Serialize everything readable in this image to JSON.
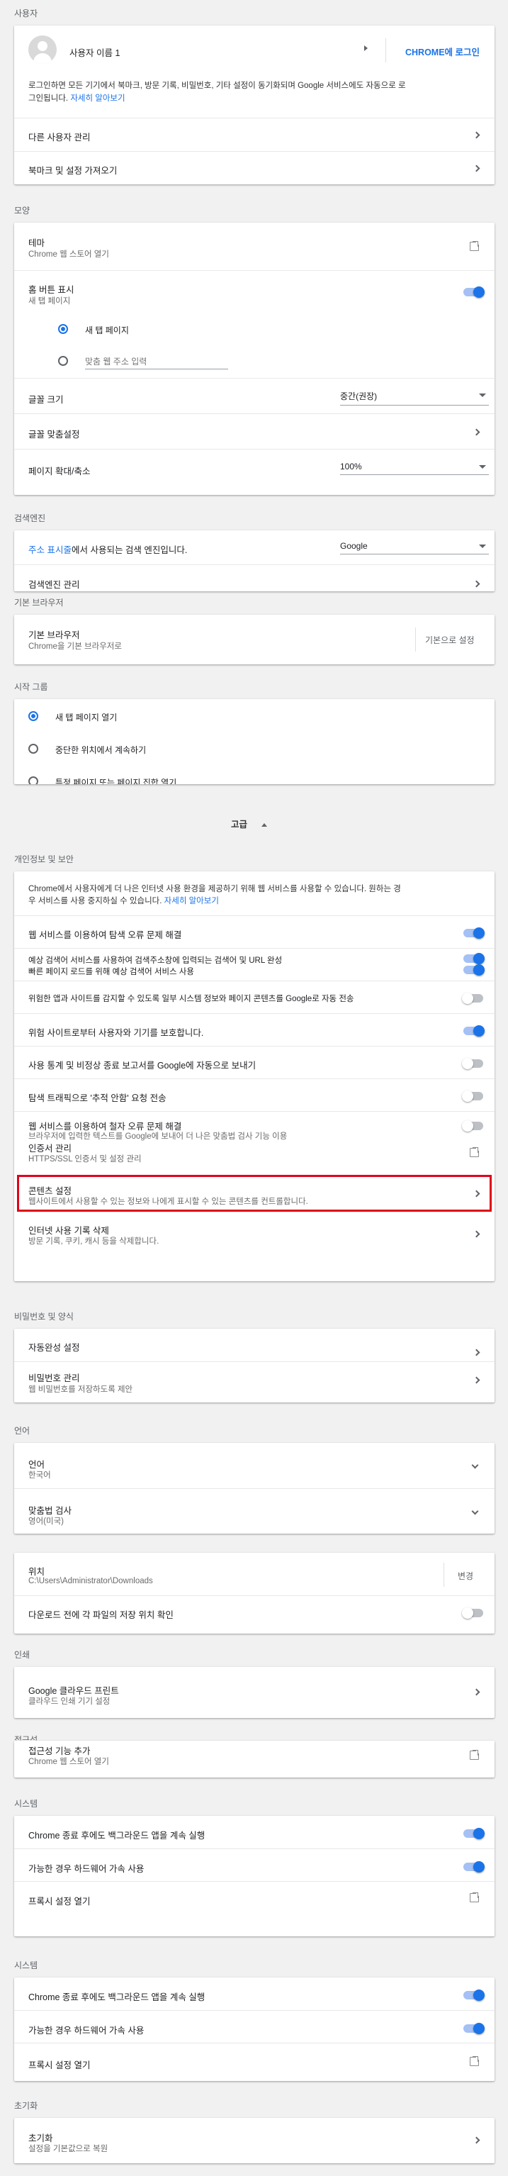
{
  "people": {
    "header": "사용자",
    "profile_name": "사용자 이름 1",
    "signin_label": "CHROME에 로그인",
    "signin_desc": "로그인하면 모든 기기에서 북마크, 방문 기록, 비밀번호, 기타 설정이 동기화되며 Google 서비스에도 자동으로 로",
    "signin_desc2": "그인됩니다.",
    "learn_more": "자세히 알아보기",
    "manage_people": "다른 사용자 관리",
    "import": "북마크 및 설정 가져오기"
  },
  "appearance": {
    "header": "모양",
    "theme": "테마",
    "theme_sub": "Chrome 웹 스토어 열기",
    "home_button": "홈 버튼 표시",
    "home_sub": "새 탭 페이지",
    "radio_newtab": "새 탭 페이지",
    "radio_custom_placeholder": "맞춤 웹 주소 입력",
    "font_size": "글꼴 크기",
    "font_size_value": "중간(권장)",
    "customize_fonts": "글꼴 맞춤설정",
    "page_zoom": "페이지 확대/축소",
    "page_zoom_value": "100%"
  },
  "search": {
    "header": "검색엔진",
    "address_bar_link": "주소 표시줄",
    "address_bar_rest": "에서 사용되는 검색 엔진입니다.",
    "engine_value": "Google",
    "manage": "검색엔진 관리"
  },
  "default_browser": {
    "header": "기본 브라우저",
    "title": "기본 브라우저",
    "sub": "Chrome을 기본 브라우저로",
    "button": "기본으로 설정"
  },
  "startup": {
    "header": "시작 그룹",
    "opt1": "새 탭 페이지 열기",
    "opt2": "중단한 위치에서 계속하기",
    "opt3": "특정 페이지 또는 페이지 집합 열기"
  },
  "advanced": {
    "label": "고급"
  },
  "privacy": {
    "header": "개인정보 및 보안",
    "intro1": "Chrome에서 사용자에게 더 나은 인터넷 사용 환경을 제공하기 위해 웹 서비스를 사용할 수 있습니다. 원하는 경",
    "intro2": "우 서비스를 사용 중지하실 수 있습니다.",
    "learn_more": "자세히 알아보기",
    "items": [
      {
        "label": "웹 서비스를 이용하여 탐색 오류 문제 해결"
      },
      {
        "label": "예상 검색어 서비스를 사용하여 검색주소창에 입력되는 검색어 및 URL 완성",
        "label2": "빠른 페이지 로드를 위해 예상 검색어 서비스 사용"
      },
      {
        "label": "위험한 앱과 사이트를 감지할 수 있도록 일부 시스템 정보와 페이지 콘텐츠를 Google로 자동 전송"
      },
      {
        "label": "위험 사이트로부터 사용자와 기기를 보호합니다."
      },
      {
        "label": "사용 통계 및 비정상 종료 보고서를 Google에 자동으로 보내기"
      },
      {
        "label": "탐색 트래픽으로 '추적 안함' 요청 전송"
      },
      {
        "label": "웹 서비스를 이용하여 철자 오류 문제 해결",
        "sub": "브라우저에 입력한 텍스트를 Google에 보내어 더 나은 맞춤법 검사 기능 이용"
      },
      {
        "label": "인증서 관리",
        "sub": "HTTPS/SSL 인증서 및 설정 관리"
      }
    ],
    "content_settings": "콘텐츠 설정",
    "content_settings_sub": "웹사이트에서 사용할 수 있는 정보와 나에게 표시할 수 있는 콘텐츠를 컨트롤합니다.",
    "clear_data": "인터넷 사용 기록 삭제",
    "clear_data_sub": "방문 기록, 쿠키, 캐시 등을 삭제합니다."
  },
  "passwords": {
    "header": "비밀번호 및 양식",
    "autofill": "자동완성 설정",
    "passwords": "비밀번호 관리",
    "passwords_sub": "웹 비밀번호를 저장하도록 제안"
  },
  "languages": {
    "header": "언어",
    "language": "언어",
    "language_value": "한국어",
    "spell": "맞춤법 검사",
    "spell_value": "영어(미국)"
  },
  "downloads": {
    "location": "위치",
    "path": "C:\\Users\\Administrator\\Downloads",
    "change": "변경",
    "ask": "다운로드 전에 각 파일의 저장 위치 확인"
  },
  "printing": {
    "header": "인쇄",
    "cloud_print": "Google 클라우드 프린트",
    "cloud_print_sub": "클라우드 인쇄 기기 설정"
  },
  "accessibility": {
    "header": "접근성",
    "add": "접근성 기능 추가",
    "add_sub": "Chrome 웹 스토어 열기"
  },
  "system": {
    "header": "시스템",
    "bg_apps": "Chrome 종료 후에도 백그라운드 앱을 계속 실행",
    "hw_accel": "가능한 경우 하드웨어 가속 사용",
    "proxy": "프록시 설정 열기"
  },
  "reset": {
    "header": "초기화",
    "title": "초기화",
    "sub": "설정을 기본값으로 복원"
  },
  "colors": {
    "accent": "#1a73e8",
    "highlight_border": "#e0001b"
  }
}
